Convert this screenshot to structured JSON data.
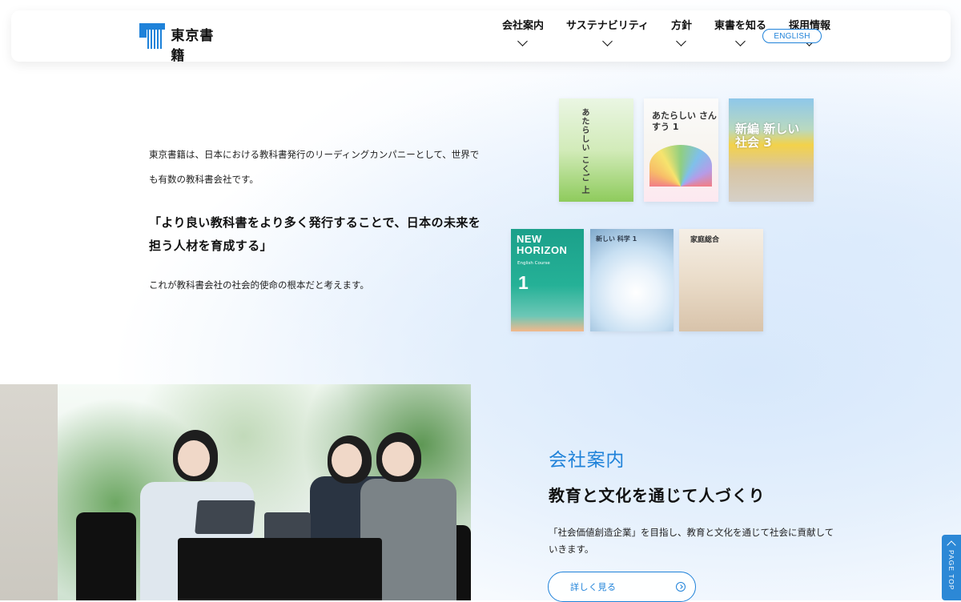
{
  "header": {
    "logo_text": "東京書籍",
    "nav": [
      {
        "label": "会社案内"
      },
      {
        "label": "サステナビリティ"
      },
      {
        "label": "方針"
      },
      {
        "label": "東書を知る"
      },
      {
        "label": "採用情報"
      }
    ],
    "english_label": "ENGLISH"
  },
  "intro": {
    "text1": "東京書籍は、日本における教科書発行のリーディングカンパニーとして、世界でも有数の教科書会社です。",
    "quote": "「より良い教科書をより多く発行することで、日本の未来を担う人材を育成する」",
    "text2": "これが教科書会社の社会的使命の根本だと考えます。"
  },
  "books": {
    "kokugo": "あたらしい こくご 上",
    "sansu": "あたらしい さんすう 1",
    "shakai": "新編 新しい 社会 3",
    "horizon_title": "NEW\nHORIZON",
    "horizon_subtitle": "English Course",
    "horizon_grade": "1",
    "kagaku": "新しい 科学 1",
    "katei": "家庭総合"
  },
  "company": {
    "heading": "会社案内",
    "title": "教育と文化を通じて人づくり",
    "text": "「社会価値創造企業」を目指し、教育と文化を通じて社会に貢献していきます。",
    "button_label": "詳しく見る"
  },
  "page_top": {
    "label": "PAGE TOP"
  },
  "colors": {
    "accent": "#1f82d9",
    "text": "#111111"
  }
}
